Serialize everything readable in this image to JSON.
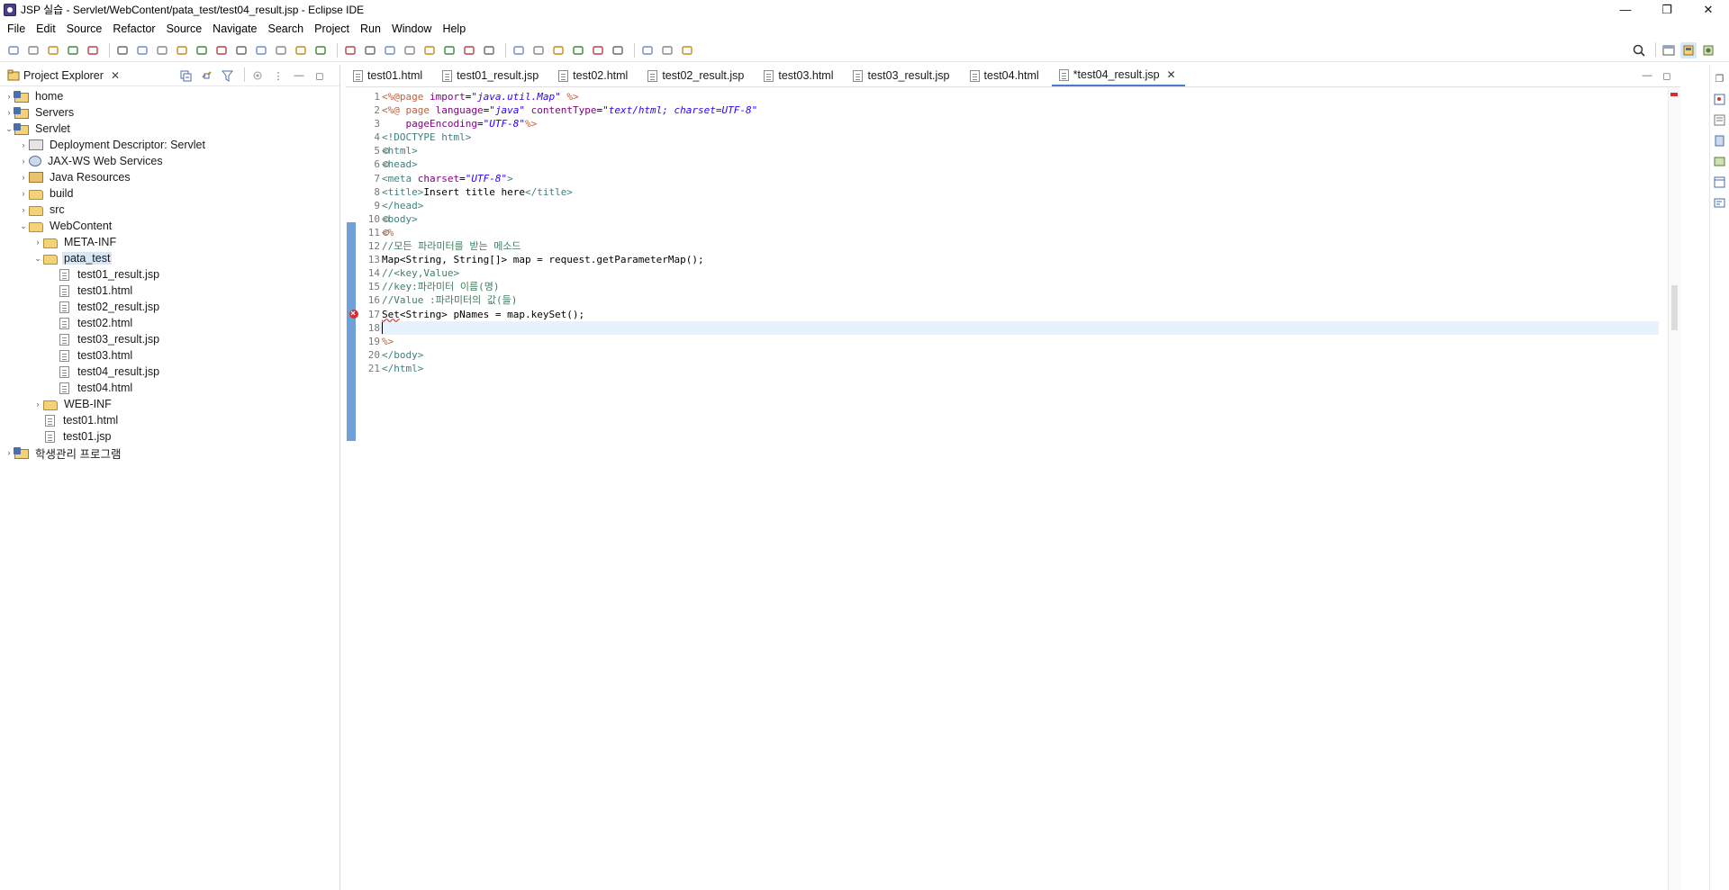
{
  "window": {
    "title": "JSP 실습 - Servlet/WebContent/pata_test/test04_result.jsp - Eclipse IDE",
    "controls": [
      "—",
      "❐",
      "✕"
    ]
  },
  "menu": [
    "File",
    "Edit",
    "Source",
    "Refactor",
    "Source",
    "Navigate",
    "Search",
    "Project",
    "Run",
    "Window",
    "Help"
  ],
  "project_explorer": {
    "title": "Project Explorer",
    "tree": [
      {
        "label": "home",
        "depth": 0,
        "icon": "project-icon",
        "arrow": "›",
        "selected": false
      },
      {
        "label": "Servers",
        "depth": 0,
        "icon": "project-icon",
        "arrow": "›",
        "selected": false
      },
      {
        "label": "Servlet",
        "depth": 0,
        "icon": "project-icon",
        "arrow": "⌄",
        "selected": false
      },
      {
        "label": "Deployment Descriptor: Servlet",
        "depth": 1,
        "icon": "descriptor-icon",
        "arrow": "›",
        "selected": false
      },
      {
        "label": "JAX-WS Web Services",
        "depth": 1,
        "icon": "web-services-icon",
        "arrow": "›",
        "selected": false
      },
      {
        "label": "Java Resources",
        "depth": 1,
        "icon": "library-icon",
        "arrow": "›",
        "selected": false
      },
      {
        "label": "build",
        "depth": 1,
        "icon": "folder-icon",
        "arrow": "›",
        "selected": false
      },
      {
        "label": "src",
        "depth": 1,
        "icon": "folder-icon",
        "arrow": "›",
        "selected": false
      },
      {
        "label": "WebContent",
        "depth": 1,
        "icon": "folder-icon",
        "arrow": "⌄",
        "selected": false
      },
      {
        "label": "META-INF",
        "depth": 2,
        "icon": "folder-icon",
        "arrow": "›",
        "selected": false
      },
      {
        "label": "pata_test",
        "depth": 2,
        "icon": "folder-icon",
        "arrow": "⌄",
        "selected": true
      },
      {
        "label": "test01_result.jsp",
        "depth": 3,
        "icon": "file-icon",
        "arrow": "",
        "selected": false
      },
      {
        "label": "test01.html",
        "depth": 3,
        "icon": "file-icon",
        "arrow": "",
        "selected": false
      },
      {
        "label": "test02_result.jsp",
        "depth": 3,
        "icon": "file-icon",
        "arrow": "",
        "selected": false
      },
      {
        "label": "test02.html",
        "depth": 3,
        "icon": "file-icon",
        "arrow": "",
        "selected": false
      },
      {
        "label": "test03_result.jsp",
        "depth": 3,
        "icon": "file-icon",
        "arrow": "",
        "selected": false
      },
      {
        "label": "test03.html",
        "depth": 3,
        "icon": "file-icon",
        "arrow": "",
        "selected": false
      },
      {
        "label": "test04_result.jsp",
        "depth": 3,
        "icon": "file-icon",
        "arrow": "",
        "selected": false
      },
      {
        "label": "test04.html",
        "depth": 3,
        "icon": "file-icon",
        "arrow": "",
        "selected": false
      },
      {
        "label": "WEB-INF",
        "depth": 2,
        "icon": "folder-icon",
        "arrow": "›",
        "selected": false
      },
      {
        "label": "test01.html",
        "depth": 2,
        "icon": "file-icon",
        "arrow": "",
        "selected": false
      },
      {
        "label": "test01.jsp",
        "depth": 2,
        "icon": "file-icon",
        "arrow": "",
        "selected": false
      },
      {
        "label": "학생관리 프로그램",
        "depth": 0,
        "icon": "project-icon",
        "arrow": "›",
        "selected": false
      }
    ]
  },
  "editor": {
    "tabs": [
      {
        "label": "test01.html",
        "active": false
      },
      {
        "label": "test01_result.jsp",
        "active": false
      },
      {
        "label": "test02.html",
        "active": false
      },
      {
        "label": "test02_result.jsp",
        "active": false
      },
      {
        "label": "test03.html",
        "active": false
      },
      {
        "label": "test03_result.jsp",
        "active": false
      },
      {
        "label": "test04.html",
        "active": false
      },
      {
        "label": "*test04_result.jsp",
        "active": true
      }
    ],
    "lines": [
      {
        "n": "1",
        "fold": false,
        "error": false,
        "current": false,
        "parts": [
          [
            "jsp",
            "<%@page "
          ],
          [
            "attr",
            "import"
          ],
          [
            "plain",
            "="
          ],
          [
            "str",
            "\"java.util.Map\""
          ],
          [
            "jsp",
            " %>"
          ]
        ]
      },
      {
        "n": "2",
        "fold": false,
        "error": false,
        "current": false,
        "parts": [
          [
            "jsp",
            "<%@ page "
          ],
          [
            "attr",
            "language"
          ],
          [
            "plain",
            "="
          ],
          [
            "str",
            "\"java\""
          ],
          [
            "plain",
            " "
          ],
          [
            "attr",
            "contentType"
          ],
          [
            "plain",
            "="
          ],
          [
            "str",
            "\"text/html; charset=UTF-8\""
          ]
        ]
      },
      {
        "n": "3",
        "fold": false,
        "error": false,
        "current": false,
        "parts": [
          [
            "plain",
            "    "
          ],
          [
            "attr",
            "pageEncoding"
          ],
          [
            "plain",
            "="
          ],
          [
            "str",
            "\"UTF-8\""
          ],
          [
            "jsp",
            "%>"
          ]
        ]
      },
      {
        "n": "4",
        "fold": false,
        "error": false,
        "current": false,
        "parts": [
          [
            "tag",
            "<!DOCTYPE html>"
          ]
        ]
      },
      {
        "n": "5",
        "fold": true,
        "error": false,
        "current": false,
        "parts": [
          [
            "tag",
            "<html>"
          ]
        ]
      },
      {
        "n": "6",
        "fold": true,
        "error": false,
        "current": false,
        "parts": [
          [
            "tag",
            "<head>"
          ]
        ]
      },
      {
        "n": "7",
        "fold": false,
        "error": false,
        "current": false,
        "parts": [
          [
            "tag",
            "<meta "
          ],
          [
            "attr",
            "charset"
          ],
          [
            "plain",
            "="
          ],
          [
            "str",
            "\"UTF-8\""
          ],
          [
            "tag",
            ">"
          ]
        ]
      },
      {
        "n": "8",
        "fold": false,
        "error": false,
        "current": false,
        "parts": [
          [
            "tag",
            "<title>"
          ],
          [
            "plain",
            "Insert title here"
          ],
          [
            "tag",
            "</title>"
          ]
        ]
      },
      {
        "n": "9",
        "fold": false,
        "error": false,
        "current": false,
        "parts": [
          [
            "tag",
            "</head>"
          ]
        ]
      },
      {
        "n": "10",
        "fold": true,
        "error": false,
        "current": false,
        "parts": [
          [
            "tag",
            "<body>"
          ]
        ]
      },
      {
        "n": "11",
        "fold": true,
        "error": false,
        "current": false,
        "parts": [
          [
            "jsp",
            "<%"
          ]
        ]
      },
      {
        "n": "12",
        "fold": false,
        "error": false,
        "current": false,
        "parts": [
          [
            "cmt",
            "//모든 파라미터를 받는 메소드"
          ]
        ]
      },
      {
        "n": "13",
        "fold": false,
        "error": false,
        "current": false,
        "parts": [
          [
            "plain",
            "Map<String, String[]> map = request.getParameterMap();"
          ]
        ]
      },
      {
        "n": "14",
        "fold": false,
        "error": false,
        "current": false,
        "parts": [
          [
            "cmt",
            "//<key,Value>"
          ]
        ]
      },
      {
        "n": "15",
        "fold": false,
        "error": false,
        "current": false,
        "parts": [
          [
            "cmt",
            "//key:파라미터 이름(명)"
          ]
        ]
      },
      {
        "n": "16",
        "fold": false,
        "error": false,
        "current": false,
        "parts": [
          [
            "cmt",
            "//Value :파라미터의 값(들)"
          ]
        ]
      },
      {
        "n": "17",
        "fold": false,
        "error": true,
        "current": false,
        "parts": [
          [
            "err",
            "Set"
          ],
          [
            "plain",
            "<String> pNames = map.keySet();"
          ]
        ]
      },
      {
        "n": "18",
        "fold": false,
        "error": false,
        "current": true,
        "parts": [
          [
            "plain",
            ""
          ]
        ]
      },
      {
        "n": "19",
        "fold": false,
        "error": false,
        "current": false,
        "parts": [
          [
            "jsp",
            "%>"
          ]
        ]
      },
      {
        "n": "20",
        "fold": false,
        "error": false,
        "current": false,
        "parts": [
          [
            "tag",
            "</body>"
          ]
        ]
      },
      {
        "n": "21",
        "fold": false,
        "error": false,
        "current": false,
        "parts": [
          [
            "tag",
            "</html>"
          ]
        ]
      }
    ]
  },
  "toolbar_icons": [
    "new-icon",
    "save-icon",
    "save-all-icon",
    "undo-icon",
    "redo-icon",
    "console-icon",
    "skip-breakpoints-icon",
    "resume-icon",
    "suspend-icon",
    "terminate-icon",
    "disconnect-icon",
    "step-into-icon",
    "step-over-icon",
    "step-return-icon",
    "drop-to-frame-icon",
    "use-step-filters-icon",
    "debug-icon",
    "run-icon",
    "coverage-icon",
    "external-tools-icon",
    "new-server-icon",
    "new-web-icon",
    "open-type-icon",
    "open-task-icon",
    "search-icon",
    "globe-icon",
    "ant-icon",
    "next-annotation-icon",
    "prev-annotation-icon",
    "last-edit-icon",
    "back-icon",
    "forward-icon",
    "pin-editor-icon"
  ],
  "colors": {
    "accent": "#4a7cc9",
    "selection": "#d6e8f7",
    "current_line": "#e8f2fe",
    "error": "#d33131",
    "change_bar": "#6fa0da"
  }
}
